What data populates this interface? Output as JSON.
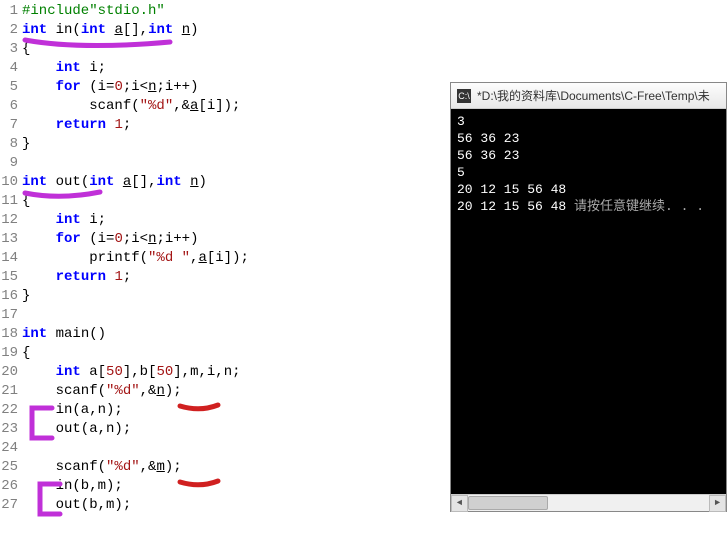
{
  "editor": {
    "lines": [
      {
        "n": "1",
        "segs": [
          {
            "t": "#include\"stdio.h\"",
            "c": "inc"
          }
        ]
      },
      {
        "n": "2",
        "segs": [
          {
            "t": "int",
            "c": "kw"
          },
          {
            "t": " in(",
            "c": ""
          },
          {
            "t": "int",
            "c": "kw"
          },
          {
            "t": " ",
            "c": ""
          },
          {
            "t": "a",
            "c": "underline"
          },
          {
            "t": "[],",
            "c": ""
          },
          {
            "t": "int",
            "c": "kw"
          },
          {
            "t": " ",
            "c": ""
          },
          {
            "t": "n",
            "c": "underline"
          },
          {
            "t": ")",
            "c": ""
          }
        ]
      },
      {
        "n": "3",
        "segs": [
          {
            "t": "{",
            "c": ""
          }
        ]
      },
      {
        "n": "4",
        "segs": [
          {
            "t": "    ",
            "c": ""
          },
          {
            "t": "int",
            "c": "kw"
          },
          {
            "t": " i;",
            "c": ""
          }
        ]
      },
      {
        "n": "5",
        "segs": [
          {
            "t": "    ",
            "c": ""
          },
          {
            "t": "for",
            "c": "kw"
          },
          {
            "t": " (i=",
            "c": ""
          },
          {
            "t": "0",
            "c": "num"
          },
          {
            "t": ";i<",
            "c": ""
          },
          {
            "t": "n",
            "c": "underline"
          },
          {
            "t": ";i++)",
            "c": ""
          }
        ]
      },
      {
        "n": "6",
        "segs": [
          {
            "t": "        scanf(",
            "c": ""
          },
          {
            "t": "\"%d\"",
            "c": "str"
          },
          {
            "t": ",&",
            "c": ""
          },
          {
            "t": "a",
            "c": "underline"
          },
          {
            "t": "[i]);",
            "c": ""
          }
        ]
      },
      {
        "n": "7",
        "segs": [
          {
            "t": "    ",
            "c": ""
          },
          {
            "t": "return",
            "c": "kw"
          },
          {
            "t": " ",
            "c": ""
          },
          {
            "t": "1",
            "c": "num"
          },
          {
            "t": ";",
            "c": ""
          }
        ]
      },
      {
        "n": "8",
        "segs": [
          {
            "t": "}",
            "c": ""
          }
        ]
      },
      {
        "n": "9",
        "segs": [
          {
            "t": "",
            "c": ""
          }
        ]
      },
      {
        "n": "10",
        "segs": [
          {
            "t": "int",
            "c": "kw"
          },
          {
            "t": " out(",
            "c": ""
          },
          {
            "t": "int",
            "c": "kw"
          },
          {
            "t": " ",
            "c": ""
          },
          {
            "t": "a",
            "c": "underline"
          },
          {
            "t": "[],",
            "c": ""
          },
          {
            "t": "int",
            "c": "kw"
          },
          {
            "t": " ",
            "c": ""
          },
          {
            "t": "n",
            "c": "underline"
          },
          {
            "t": ")",
            "c": ""
          }
        ]
      },
      {
        "n": "11",
        "segs": [
          {
            "t": "{",
            "c": ""
          }
        ]
      },
      {
        "n": "12",
        "segs": [
          {
            "t": "    ",
            "c": ""
          },
          {
            "t": "int",
            "c": "kw"
          },
          {
            "t": " i;",
            "c": ""
          }
        ]
      },
      {
        "n": "13",
        "segs": [
          {
            "t": "    ",
            "c": ""
          },
          {
            "t": "for",
            "c": "kw"
          },
          {
            "t": " (i=",
            "c": ""
          },
          {
            "t": "0",
            "c": "num"
          },
          {
            "t": ";i<",
            "c": ""
          },
          {
            "t": "n",
            "c": "underline"
          },
          {
            "t": ";i++)",
            "c": ""
          }
        ]
      },
      {
        "n": "14",
        "segs": [
          {
            "t": "        printf(",
            "c": ""
          },
          {
            "t": "\"%d \"",
            "c": "str"
          },
          {
            "t": ",",
            "c": ""
          },
          {
            "t": "a",
            "c": "underline"
          },
          {
            "t": "[i]);",
            "c": ""
          }
        ]
      },
      {
        "n": "15",
        "segs": [
          {
            "t": "    ",
            "c": ""
          },
          {
            "t": "return",
            "c": "kw"
          },
          {
            "t": " ",
            "c": ""
          },
          {
            "t": "1",
            "c": "num"
          },
          {
            "t": ";",
            "c": ""
          }
        ]
      },
      {
        "n": "16",
        "segs": [
          {
            "t": "}",
            "c": ""
          }
        ]
      },
      {
        "n": "17",
        "segs": [
          {
            "t": "",
            "c": ""
          }
        ]
      },
      {
        "n": "18",
        "segs": [
          {
            "t": "int",
            "c": "kw"
          },
          {
            "t": " main()",
            "c": ""
          }
        ]
      },
      {
        "n": "19",
        "segs": [
          {
            "t": "{",
            "c": ""
          }
        ]
      },
      {
        "n": "20",
        "segs": [
          {
            "t": "    ",
            "c": ""
          },
          {
            "t": "int",
            "c": "kw"
          },
          {
            "t": " a[",
            "c": ""
          },
          {
            "t": "50",
            "c": "num"
          },
          {
            "t": "],b[",
            "c": ""
          },
          {
            "t": "50",
            "c": "num"
          },
          {
            "t": "],m,i,n;",
            "c": ""
          }
        ]
      },
      {
        "n": "21",
        "segs": [
          {
            "t": "    scanf(",
            "c": ""
          },
          {
            "t": "\"%d\"",
            "c": "str"
          },
          {
            "t": ",&",
            "c": ""
          },
          {
            "t": "n",
            "c": "underline"
          },
          {
            "t": ");",
            "c": ""
          }
        ]
      },
      {
        "n": "22",
        "segs": [
          {
            "t": "    in(a,n);",
            "c": ""
          }
        ]
      },
      {
        "n": "23",
        "segs": [
          {
            "t": "    out(a,n);",
            "c": ""
          }
        ]
      },
      {
        "n": "24",
        "segs": [
          {
            "t": "",
            "c": ""
          }
        ]
      },
      {
        "n": "25",
        "segs": [
          {
            "t": "    scanf(",
            "c": ""
          },
          {
            "t": "\"%d\"",
            "c": "str"
          },
          {
            "t": ",&",
            "c": ""
          },
          {
            "t": "m",
            "c": "underline"
          },
          {
            "t": ");",
            "c": ""
          }
        ]
      },
      {
        "n": "26",
        "segs": [
          {
            "t": "    in(b,m);",
            "c": ""
          }
        ]
      },
      {
        "n": "27",
        "segs": [
          {
            "t": "    out(b,m);",
            "c": ""
          }
        ]
      }
    ]
  },
  "console": {
    "title": "*D:\\我的资料库\\Documents\\C-Free\\Temp\\未",
    "lines": [
      "3",
      "56 36 23",
      "56 36 23",
      "5",
      "20 12 15 56 48",
      "20 12 15 56 48 请按任意键继续. . ."
    ]
  },
  "annotations": {
    "color_purple": "#c030d8",
    "color_red": "#d02020"
  }
}
